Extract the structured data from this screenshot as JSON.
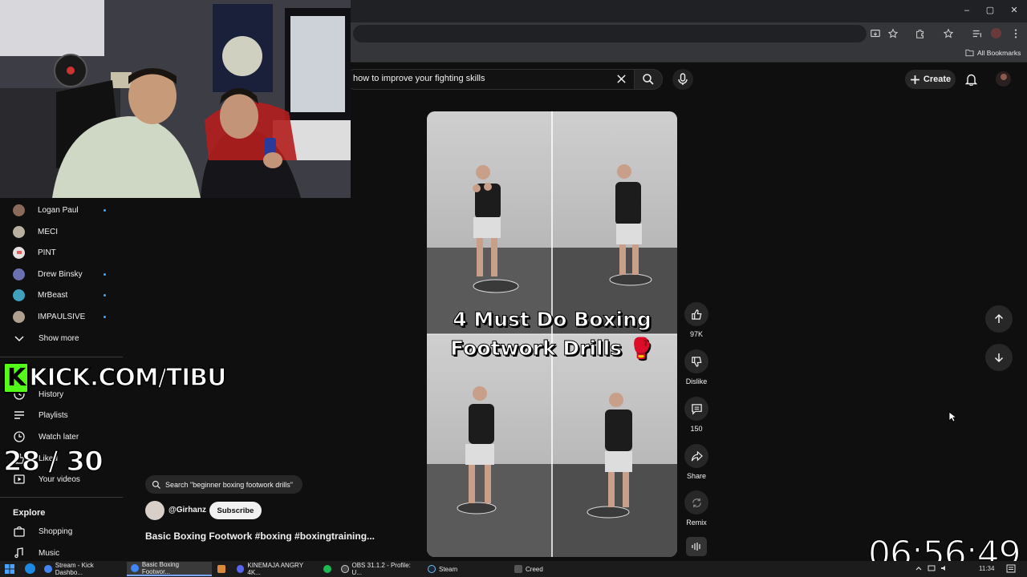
{
  "browser": {
    "bookmarks_label": "All Bookmarks",
    "window_controls": [
      "–",
      "▢",
      "✕"
    ]
  },
  "header": {
    "search_query": "how to improve your fighting skills",
    "create_label": "Create"
  },
  "sidebar": {
    "subscriptions": [
      {
        "label": "Logan Paul",
        "avatar_color": "#8a6a5a",
        "new": true
      },
      {
        "label": "MECI",
        "avatar_color": "#b8b0a0",
        "new": false
      },
      {
        "label": "PINT",
        "avatar_color": "#e06060",
        "new": false
      },
      {
        "label": "Drew Binsky",
        "avatar_color": "#6a70b0",
        "new": true
      },
      {
        "label": "MrBeast",
        "avatar_color": "#3fa0c0",
        "new": true
      },
      {
        "label": "IMPAULSIVE",
        "avatar_color": "#b0a090",
        "new": true
      }
    ],
    "show_more": "Show more",
    "you_items": [
      {
        "label": "History",
        "icon": "history-icon"
      },
      {
        "label": "Playlists",
        "icon": "playlists-icon"
      },
      {
        "label": "Watch later",
        "icon": "watch-later-icon"
      },
      {
        "label": "Liked",
        "icon": "liked-icon"
      },
      {
        "label": "Your videos",
        "icon": "your-videos-icon"
      }
    ],
    "explore_heading": "Explore",
    "explore_items": [
      {
        "label": "Shopping",
        "icon": "shopping-icon"
      },
      {
        "label": "Music",
        "icon": "music-icon"
      }
    ]
  },
  "short": {
    "related_search": "Search \"beginner boxing footwork drills\"",
    "channel": "@Girhanz",
    "subscribe_label": "Subscribe",
    "title": "Basic Boxing Footwork #boxing #boxingtraining...",
    "overlay_line1": "4 Must Do Boxing",
    "overlay_line2": "Footwork Drills 🥊",
    "actions": {
      "like_count": "97K",
      "dislike_label": "Dislike",
      "comment_count": "150",
      "share_label": "Share",
      "remix_label": "Remix"
    }
  },
  "stream_overlay": {
    "kick_text": "KICK.COM/TIBU",
    "counter": "28 / 30",
    "clock": "06:56:49"
  },
  "taskbar": {
    "tasks": [
      {
        "label": "Stream - Kick Dashbo...",
        "color": "#4285f4",
        "active": false
      },
      {
        "label": "Basic Boxing Footwor...",
        "color": "#4285f4",
        "active": true
      },
      {
        "label": "",
        "color": "#d98a3a",
        "active": false
      },
      {
        "label": "KINEMAJA ANGRY 4K...",
        "color": "#5865f2",
        "active": false
      },
      {
        "label": "",
        "color": "#1db954",
        "active": false
      },
      {
        "label": "OBS 31.1.2 - Profile: U...",
        "color": "#444",
        "active": false
      },
      {
        "label": "Steam",
        "color": "#1b2838",
        "active": false
      },
      {
        "label": "Creed",
        "color": "#555",
        "active": false
      }
    ],
    "tray_time": "11:34"
  }
}
